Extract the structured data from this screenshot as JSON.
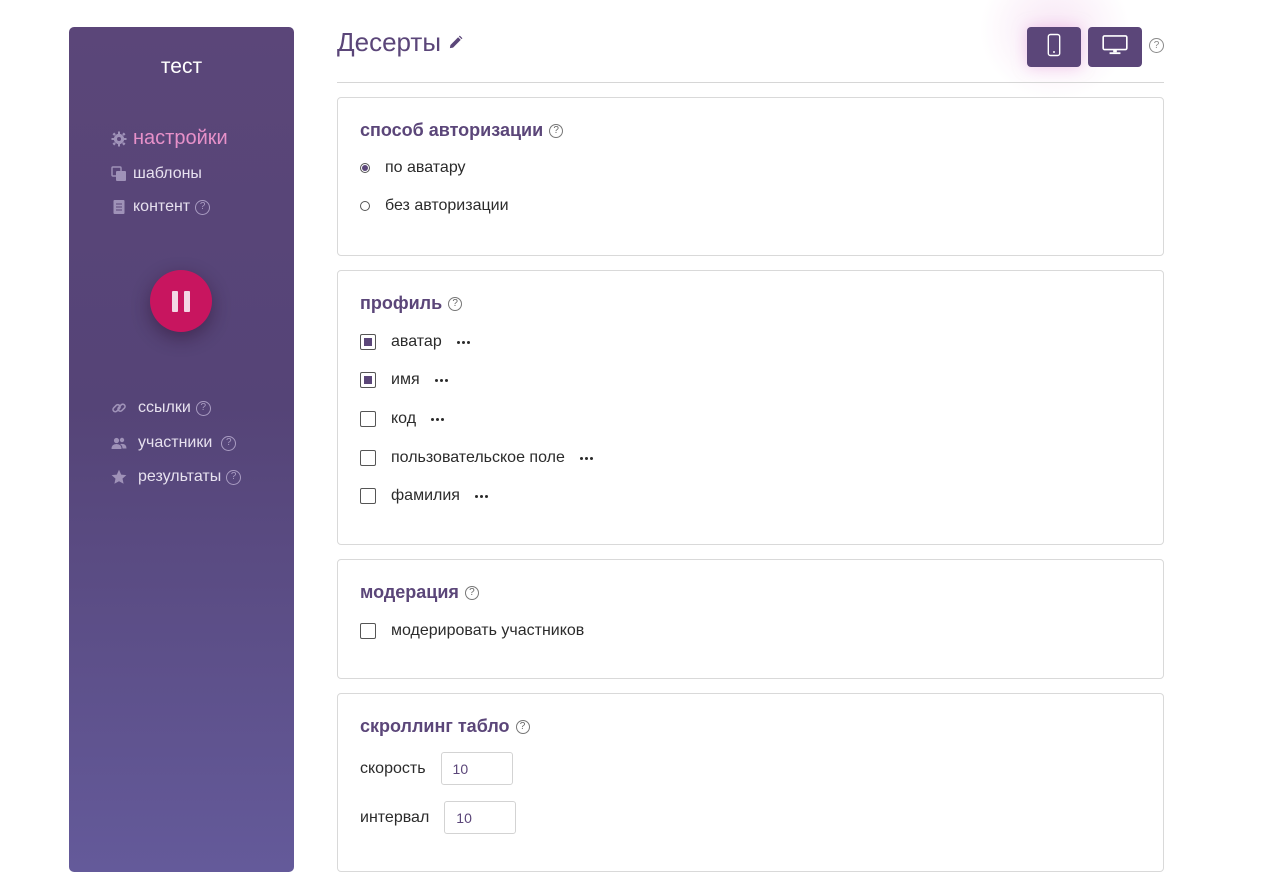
{
  "sidebar": {
    "title": "тест",
    "nav": [
      {
        "label": "настройки",
        "icon": "gear-icon",
        "active": true
      },
      {
        "label": "шаблоны",
        "icon": "templates-icon"
      },
      {
        "label": "контент",
        "icon": "document-icon",
        "help": "?"
      }
    ],
    "nav_lower": [
      {
        "label": "ссылки",
        "icon": "link-icon",
        "help": "?"
      },
      {
        "label": "участники",
        "icon": "users-icon",
        "help": "?"
      },
      {
        "label": "результаты",
        "icon": "star-icon",
        "help": "?"
      }
    ],
    "pause_icon": "pause-icon"
  },
  "header": {
    "title": "Десерты",
    "edit_icon": "pencil-icon",
    "device_buttons": [
      {
        "icon": "mobile-icon",
        "active": true
      },
      {
        "icon": "desktop-icon",
        "active": false
      }
    ],
    "help": "?"
  },
  "auth": {
    "title": "способ авторизации",
    "help": "?",
    "options": [
      {
        "label": "по аватару",
        "selected": true
      },
      {
        "label": "без авторизации",
        "selected": false
      }
    ]
  },
  "profile": {
    "title": "профиль",
    "help": "?",
    "fields": [
      {
        "label": "аватар",
        "checked": true
      },
      {
        "label": "имя",
        "checked": true
      },
      {
        "label": "код",
        "checked": false
      },
      {
        "label": "пользовательское поле",
        "checked": false
      },
      {
        "label": "фамилия",
        "checked": false
      }
    ]
  },
  "moderation": {
    "title": "модерация",
    "help": "?",
    "option": {
      "label": "модерировать участников",
      "checked": false
    }
  },
  "scrolling": {
    "title": "скроллинг табло",
    "help": "?",
    "speed": {
      "label": "скорость",
      "value": "10"
    },
    "interval": {
      "label": "интервал",
      "value": "10"
    }
  },
  "colors": {
    "accent": "#5b4679",
    "pause": "#c8155f",
    "active_nav": "#e791c9"
  }
}
